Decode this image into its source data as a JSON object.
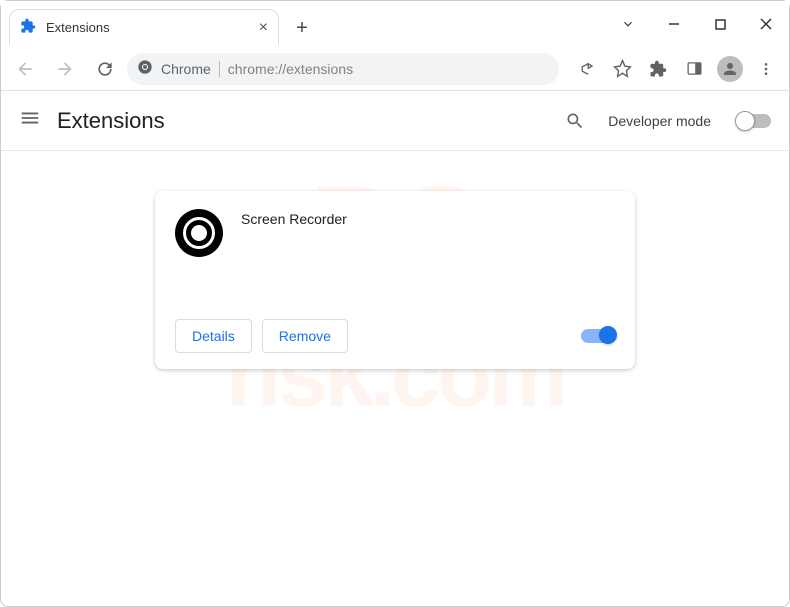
{
  "tab": {
    "title": "Extensions"
  },
  "omnibox": {
    "schemeLabel": "Chrome",
    "url": "chrome://extensions"
  },
  "header": {
    "title": "Extensions",
    "developerMode": "Developer mode"
  },
  "extension": {
    "name": "Screen Recorder",
    "detailsLabel": "Details",
    "removeLabel": "Remove",
    "enabled": true
  },
  "watermark": {
    "line1": "PC",
    "line2": "risk.com"
  }
}
